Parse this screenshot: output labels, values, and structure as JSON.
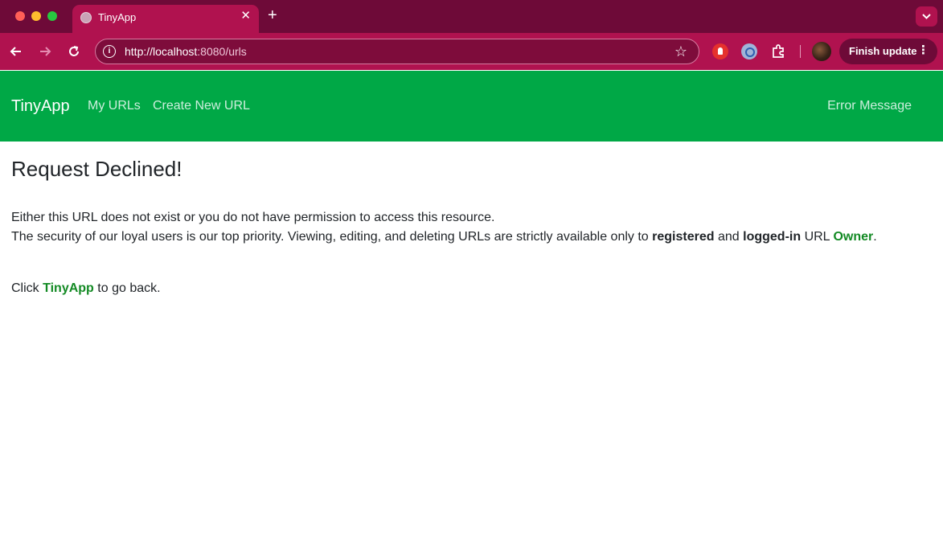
{
  "browser": {
    "tab_title": "TinyApp",
    "tab_close_glyph": "✕",
    "new_tab_glyph": "+",
    "url_scheme_host": "http://localhost",
    "url_rest": ":8080/urls",
    "star_glyph": "☆",
    "finish_update_label": "Finish update",
    "menu_glyph": "⋮",
    "icons": {
      "globe": "globe-icon",
      "back": "back-arrow-icon",
      "forward": "forward-arrow-icon",
      "reload": "reload-icon",
      "info": "info-icon",
      "star": "bookmark-star-icon",
      "extension_red": "hand-stop-extension-icon",
      "extension_blue": "circle-extension-icon",
      "puzzle": "puzzle-extensions-icon",
      "profile": "profile-avatar-icon",
      "dropdown": "chevron-down-icon"
    },
    "colors": {
      "tabbar": "#6e0a38",
      "toolbar": "#b0124f"
    }
  },
  "navbar": {
    "brand": "TinyApp",
    "links": [
      "My URLs",
      "Create New URL"
    ],
    "right_link": "Error Message",
    "background": "#00a846"
  },
  "main": {
    "heading": "Request Declined!",
    "line1": "Either this URL does not exist or you do not have permission to access this resource.",
    "line2_prefix": "The security of our loyal users is our top priority. Viewing, editing, and deleting URLs are strictly available only to",
    "line2_registered": "registered",
    "line2_and": "and",
    "line2_loggedin": "logged-in",
    "line2_url": "URL",
    "line2_owner": "Owner",
    "line2_period": ".",
    "line3_prefix": "Click",
    "line3_link": "TinyApp",
    "line3_suffix": "to go back.",
    "accent_green": "#138a24"
  }
}
